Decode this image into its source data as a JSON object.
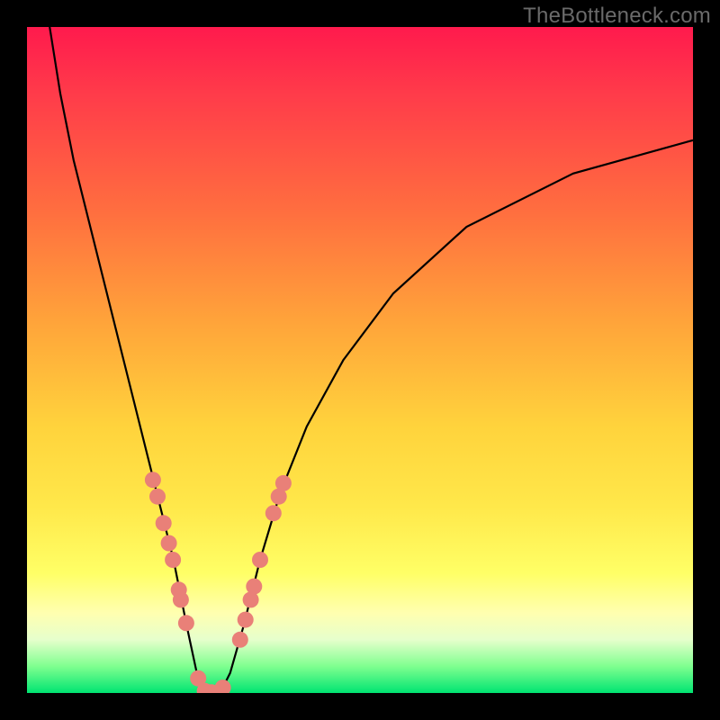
{
  "watermark": "TheBottleneck.com",
  "chart_data": {
    "type": "line",
    "title": "",
    "xlabel": "",
    "ylabel": "",
    "xlim": [
      0,
      100
    ],
    "ylim": [
      0,
      100
    ],
    "grid": false,
    "legend": false,
    "annotations": [],
    "curve_description": "V-shaped bottleneck curve descending from top-left, reaching zero near x≈27, rising with decreasing slope toward upper-right",
    "curve_points": [
      {
        "x": 3.4,
        "y": 100.0
      },
      {
        "x": 5.0,
        "y": 90.0
      },
      {
        "x": 7.0,
        "y": 80.0
      },
      {
        "x": 9.5,
        "y": 70.0
      },
      {
        "x": 12.0,
        "y": 60.0
      },
      {
        "x": 14.5,
        "y": 50.0
      },
      {
        "x": 17.0,
        "y": 40.0
      },
      {
        "x": 19.5,
        "y": 30.0
      },
      {
        "x": 22.0,
        "y": 20.0
      },
      {
        "x": 24.0,
        "y": 10.0
      },
      {
        "x": 25.5,
        "y": 3.0
      },
      {
        "x": 27.0,
        "y": 0.0
      },
      {
        "x": 29.0,
        "y": 0.0
      },
      {
        "x": 30.5,
        "y": 3.0
      },
      {
        "x": 32.5,
        "y": 10.0
      },
      {
        "x": 35.0,
        "y": 20.0
      },
      {
        "x": 38.0,
        "y": 30.0
      },
      {
        "x": 42.0,
        "y": 40.0
      },
      {
        "x": 47.5,
        "y": 50.0
      },
      {
        "x": 55.0,
        "y": 60.0
      },
      {
        "x": 66.0,
        "y": 70.0
      },
      {
        "x": 82.0,
        "y": 78.0
      },
      {
        "x": 100.0,
        "y": 83.0
      }
    ],
    "markers_description": "salmon-colored dot markers clustered on both arms of the V near the bottom",
    "markers": [
      {
        "x": 18.9,
        "y": 32.0
      },
      {
        "x": 19.6,
        "y": 29.5
      },
      {
        "x": 20.5,
        "y": 25.5
      },
      {
        "x": 21.3,
        "y": 22.5
      },
      {
        "x": 21.9,
        "y": 20.0
      },
      {
        "x": 22.8,
        "y": 15.5
      },
      {
        "x": 23.1,
        "y": 14.0
      },
      {
        "x": 23.9,
        "y": 10.5
      },
      {
        "x": 25.7,
        "y": 2.2
      },
      {
        "x": 26.7,
        "y": 0.3
      },
      {
        "x": 27.7,
        "y": 0.1
      },
      {
        "x": 28.6,
        "y": 0.0
      },
      {
        "x": 29.4,
        "y": 0.8
      },
      {
        "x": 32.0,
        "y": 8.0
      },
      {
        "x": 32.8,
        "y": 11.0
      },
      {
        "x": 33.6,
        "y": 14.0
      },
      {
        "x": 34.1,
        "y": 16.0
      },
      {
        "x": 35.0,
        "y": 20.0
      },
      {
        "x": 37.0,
        "y": 27.0
      },
      {
        "x": 37.8,
        "y": 29.5
      },
      {
        "x": 38.5,
        "y": 31.5
      }
    ],
    "marker_color": "#e98078",
    "marker_radius": 9
  }
}
